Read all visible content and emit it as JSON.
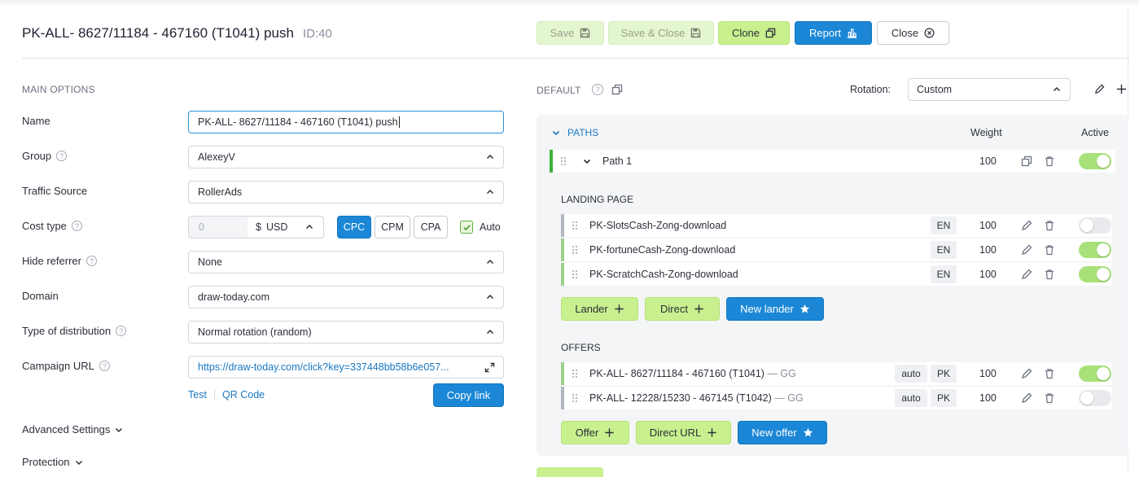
{
  "header": {
    "title": "PK-ALL- 8627/11184 - 467160 (T1041) push",
    "id_label": "ID:40",
    "buttons": {
      "save": "Save",
      "save_close": "Save & Close",
      "clone": "Clone",
      "report": "Report",
      "close": "Close"
    }
  },
  "main_options": {
    "section_title": "MAIN OPTIONS",
    "name": {
      "label": "Name",
      "value": "PK-ALL- 8627/11184 - 467160 (T1041) push"
    },
    "group": {
      "label": "Group",
      "value": "AlexeyV"
    },
    "traffic_source": {
      "label": "Traffic Source",
      "value": "RollerAds"
    },
    "cost_type": {
      "label": "Cost type",
      "amount_placeholder": "0",
      "currency_symbol": "$",
      "currency": "USD",
      "options": [
        "CPC",
        "CPM",
        "CPA"
      ],
      "selected": "CPC",
      "auto_label": "Auto",
      "auto_checked": true
    },
    "hide_referrer": {
      "label": "Hide referrer",
      "value": "None"
    },
    "domain": {
      "label": "Domain",
      "value": "draw-today.com"
    },
    "distribution": {
      "label": "Type of distribution",
      "value": "Normal rotation (random)"
    },
    "campaign_url": {
      "label": "Campaign URL",
      "value": "https://draw-today.com/click?key=337448bb58b6e057...",
      "test_link": "Test",
      "qr_link": "QR Code",
      "copy_button": "Copy link"
    },
    "advanced_settings": "Advanced Settings",
    "protection": "Protection"
  },
  "flow": {
    "default_label": "DEFAULT",
    "rotation_label": "Rotation:",
    "rotation_value": "Custom",
    "paths_title": "PATHS",
    "weight_header": "Weight",
    "active_header": "Active",
    "path": {
      "name": "Path 1",
      "weight": "100",
      "active": true
    },
    "landing_title": "LANDING PAGE",
    "landers": [
      {
        "name": "PK-SlotsCash-Zong-download",
        "lang": "EN",
        "weight": "100",
        "active": false
      },
      {
        "name": "PK-fortuneCash-Zong-download",
        "lang": "EN",
        "weight": "100",
        "active": true
      },
      {
        "name": "PK-ScratchCash-Zong-download",
        "lang": "EN",
        "weight": "100",
        "active": true
      }
    ],
    "lander_buttons": {
      "lander": "Lander",
      "direct": "Direct",
      "new_lander": "New lander"
    },
    "offers_title": "OFFERS",
    "offers": [
      {
        "name": "PK-ALL- 8627/11184 - 467160 (T1041)",
        "network": "— GG",
        "payout": "auto",
        "country": "PK",
        "weight": "100",
        "active": true
      },
      {
        "name": "PK-ALL- 12228/15230 - 467145 (T1042)",
        "network": "— GG",
        "payout": "auto",
        "country": "PK",
        "weight": "100",
        "active": false
      }
    ],
    "offer_buttons": {
      "offer": "Offer",
      "direct_url": "Direct URL",
      "new_offer": "New offer"
    }
  },
  "colors": {
    "accent_blue": "#1b87d6",
    "accent_green": "#c8f08e",
    "toggle_on": "#a8e17a",
    "panel_bg": "#f4f5f7"
  }
}
